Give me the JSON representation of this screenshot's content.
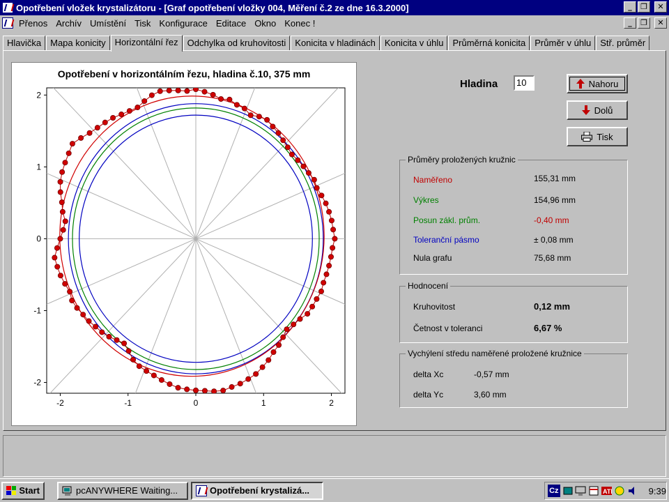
{
  "window": {
    "title": "Opotřebení vložek krystalizátoru - [Graf opotřebení vložky 004, Měření č.2 ze dne 16.3.2000]",
    "caption_buttons": [
      "_",
      "❐",
      "✕"
    ]
  },
  "menu": [
    "Přenos",
    "Archív",
    "Umístění",
    "Tisk",
    "Konfigurace",
    "Editace",
    "Okno",
    "Konec !"
  ],
  "tabs": [
    {
      "label": "Hlavička",
      "active": false
    },
    {
      "label": "Mapa konicity",
      "active": false
    },
    {
      "label": "Horizontální řez",
      "active": true
    },
    {
      "label": "Odchylka od kruhovitosti",
      "active": false
    },
    {
      "label": "Konicita v hladinách",
      "active": false
    },
    {
      "label": "Konicita v úhlu",
      "active": false
    },
    {
      "label": "Průměrná konicita",
      "active": false
    },
    {
      "label": "Průměr v úhlu",
      "active": false
    },
    {
      "label": "Stř. průměr",
      "active": false
    }
  ],
  "chart": {
    "title": "Opotřebení v horizontálním řezu, hladina č.10, 375 mm"
  },
  "chart_data": {
    "type": "scatter",
    "title": "Opotřebení v horizontálním řezu, hladina č.10, 375 mm",
    "xlim": [
      -2.2,
      2.2
    ],
    "ylim": [
      -2.15,
      2.1
    ],
    "xticks": [
      "-2",
      "-1",
      "0",
      "1",
      "2"
    ],
    "yticks": [
      "2",
      "1",
      "0",
      "-1",
      "-2"
    ],
    "grid": false,
    "polar_spokes": 16,
    "reference_circles": [
      {
        "name": "Výkres",
        "radius": 1.82,
        "color": "#008000"
      },
      {
        "name": "Toleranční pásmo (outer)",
        "radius": 1.88,
        "color": "#0000c0"
      },
      {
        "name": "Toleranční pásmo (inner)",
        "radius": 1.72,
        "color": "#0000c0"
      },
      {
        "name": "Naměřeno (fitted)",
        "radius": 1.95,
        "center": [
          -0.057,
          0.036
        ],
        "color": "#d00000"
      }
    ],
    "measured_points_polar": {
      "angles_deg_step": 3.6,
      "radii": [
        2.08,
        2.05,
        2.02,
        1.98,
        2.0,
        1.96,
        1.95,
        1.9,
        1.94,
        1.96,
        1.93,
        1.91,
        1.88,
        1.86,
        1.84,
        1.86,
        1.88,
        1.9,
        1.93,
        1.92,
        1.95,
        1.98,
        2.0,
        2.02,
        2.03,
        2.05,
        2.02,
        2.01,
        2.0,
        1.99,
        1.98,
        1.99,
        1.97,
        1.96,
        1.95,
        1.9,
        1.87,
        1.84,
        1.88,
        1.92,
        1.95,
        2.0,
        2.04,
        2.08,
        2.1,
        2.12,
        2.13,
        2.15,
        2.14,
        2.12,
        2.11,
        2.1,
        2.09,
        2.06,
        2.03,
        2.0,
        1.98,
        1.96,
        1.92,
        1.85,
        1.8,
        1.83,
        1.87,
        1.9,
        1.92,
        1.95,
        1.97,
        2.0,
        2.02,
        2.0,
        2.03,
        2.06,
        2.08,
        2.1,
        2.05,
        2.0,
        1.96,
        1.94,
        2.0,
        2.04,
        2.1,
        2.15,
        2.18,
        2.2,
        2.22,
        2.25,
        2.2,
        2.15,
        2.12,
        2.1,
        2.08,
        2.05,
        2.03,
        2.02,
        2.06,
        2.1,
        2.12,
        2.1,
        2.08,
        2.06
      ]
    },
    "points_color": "#c00000"
  },
  "controls": {
    "hladina_label": "Hladina",
    "hladina_value": "10",
    "btn_up": "Nahoru",
    "btn_down": "Dolů",
    "btn_print": "Tisk"
  },
  "prumery": {
    "legend": "Průměry proložených kružnic",
    "rows": [
      {
        "label": "Naměřeno",
        "value": "155,31 mm",
        "label_color": "#c00000",
        "value_color": "#000000"
      },
      {
        "label": "Výkres",
        "value": "154,96 mm",
        "label_color": "#008000",
        "value_color": "#000000"
      },
      {
        "label": "Posun zákl. prům.",
        "value": "-0,40 mm",
        "label_color": "#008000",
        "value_color": "#c00000"
      },
      {
        "label": "Toleranční pásmo",
        "value": "± 0,08 mm",
        "label_color": "#0000c0",
        "value_color": "#000000"
      },
      {
        "label": "Nula grafu",
        "value": "75,68 mm",
        "label_color": "#000000",
        "value_color": "#000000"
      }
    ]
  },
  "hodnoceni": {
    "legend": "Hodnocení",
    "kruhovitost_label": "Kruhovitost",
    "kruhovitost_value": "0,12 mm",
    "cetnost_label": "Četnost v toleranci",
    "cetnost_value": "6,67 %"
  },
  "vychyleni": {
    "legend": "Vychýlení středu naměřené proložené kružnice",
    "xc_label": "delta Xc",
    "xc_value": "-0,57 mm",
    "yc_label": "delta Yc",
    "yc_value": "3,60 mm"
  },
  "taskbar": {
    "start": "Start",
    "tasks": [
      {
        "label": "pcANYWHERE Waiting...",
        "active": false
      },
      {
        "label": "Opotřebení krystalizá...",
        "active": true
      }
    ],
    "clock": "9:39",
    "lang": "Cz"
  }
}
